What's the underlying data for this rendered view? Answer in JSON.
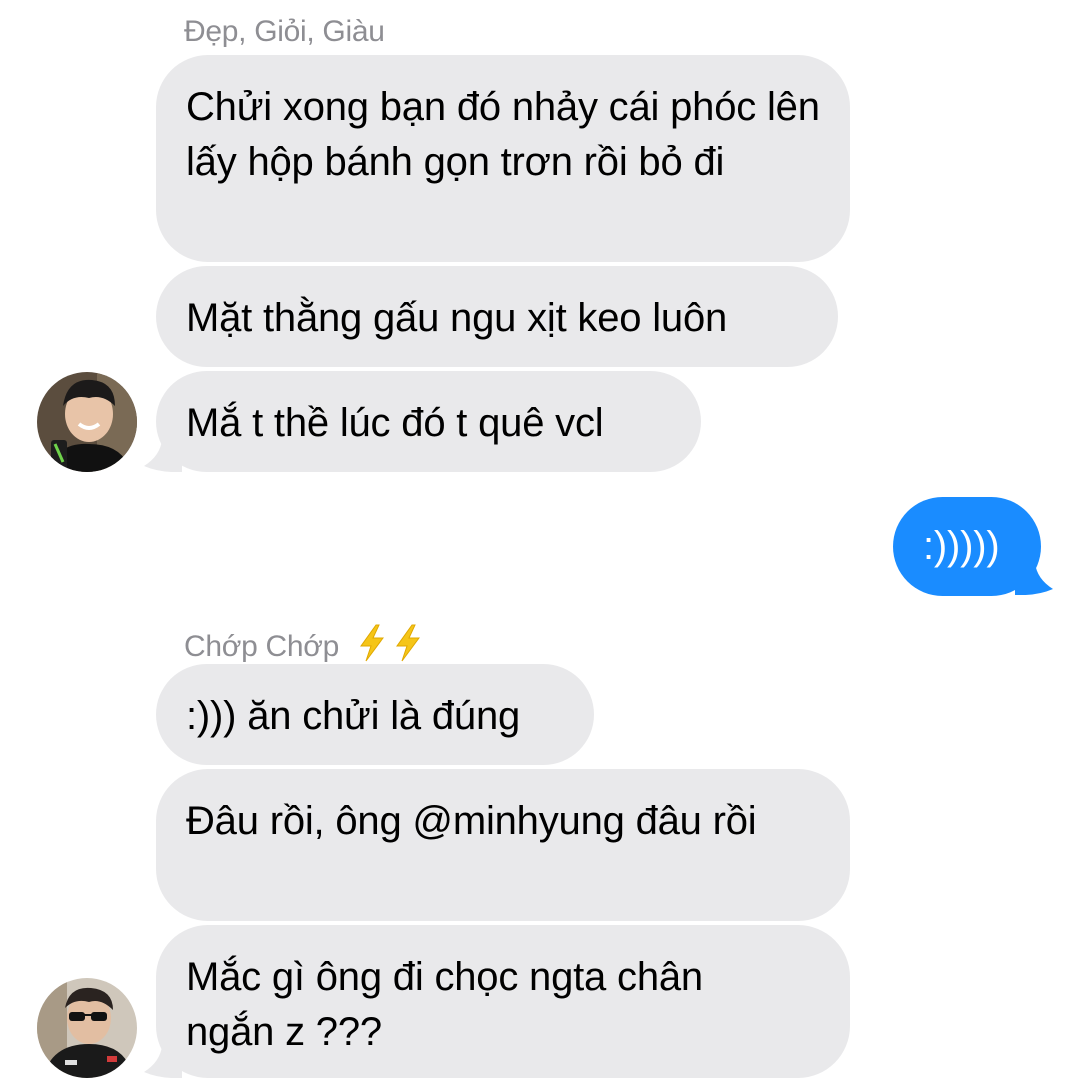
{
  "colors": {
    "incoming_bubble": "#e9e9eb",
    "outgoing_bubble": "#1a8cff",
    "sender_name": "#8e8e93",
    "bolt": "#f5c518"
  },
  "groups": [
    {
      "sender": "Đẹp, Giỏi, Giàu",
      "messages": [
        "Chửi xong bạn đó nhảy cái phóc lên lấy hộp bánh gọn trơn rồi bỏ đi",
        "Mặt thằng gấu ngu xịt keo luôn",
        "Mắ t thề lúc đó t quê vcl"
      ],
      "avatar": "avatar-photo-1"
    },
    {
      "sender": "Chớp Chớp",
      "sender_emoji": "high-voltage-icon x2",
      "messages": [
        ":))) ăn chửi là đúng",
        "Đâu rồi, ông @minhyung đâu rồi",
        "Mắc gì ông đi chọc ngta chân ngắn z ???"
      ],
      "avatar": "avatar-photo-2"
    }
  ],
  "outgoing": {
    "message": ":)))))"
  }
}
